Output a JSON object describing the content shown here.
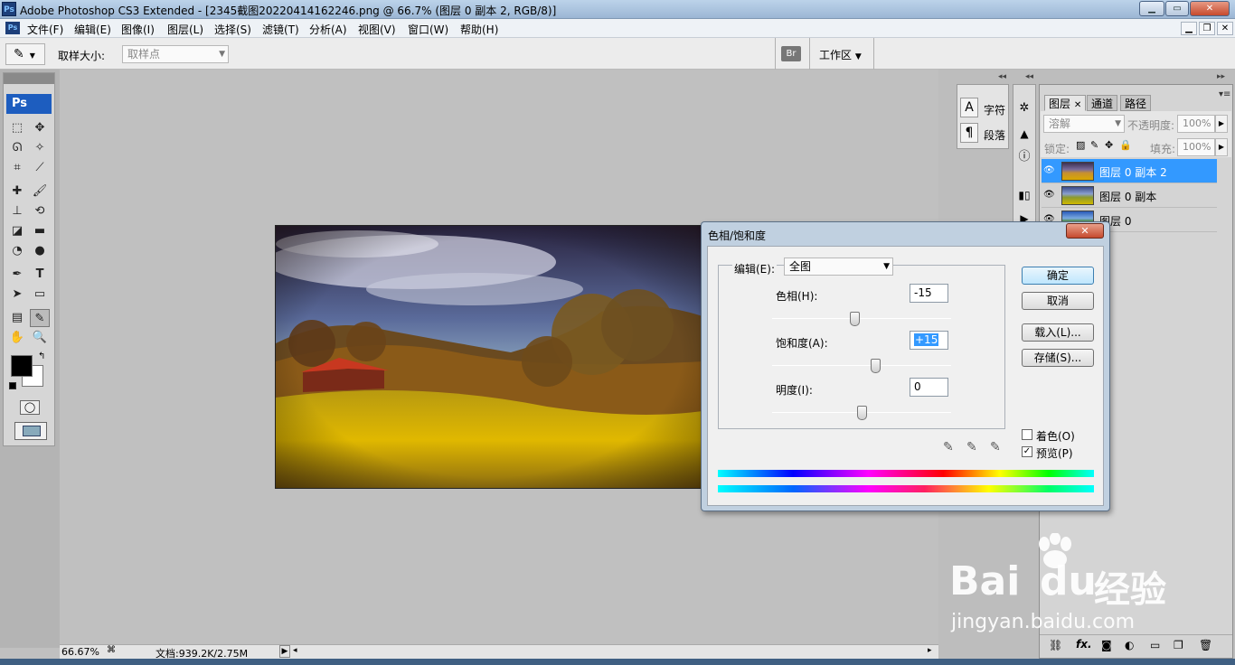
{
  "window": {
    "title": "Adobe Photoshop CS3 Extended - [2345截图20220414162246.png @ 66.7% (图层 0 副本 2, RGB/8)]",
    "app_icon": "Ps"
  },
  "menu": [
    "文件(F)",
    "编辑(E)",
    "图像(I)",
    "图层(L)",
    "选择(S)",
    "滤镜(T)",
    "分析(A)",
    "视图(V)",
    "窗口(W)",
    "帮助(H)"
  ],
  "options": {
    "sample_size_label": "取样大小:",
    "sample_size_value": "取样点",
    "workspace_label": "工作区"
  },
  "toolbox": {
    "logo": "Ps"
  },
  "status": {
    "zoom": "66.67%",
    "doc": "文档:939.2K/2.75M"
  },
  "char_panel": {
    "char_label": "字符",
    "para_label": "段落"
  },
  "layers_panel": {
    "tabs": [
      "图层",
      "通道",
      "路径"
    ],
    "blend_mode": "溶解",
    "opacity_label": "不透明度:",
    "opacity_value": "100%",
    "lock_label": "锁定:",
    "fill_label": "填充:",
    "fill_value": "100%",
    "layers": [
      {
        "name": "图层 0 副本 2",
        "selected": true
      },
      {
        "name": "图层 0 副本",
        "selected": false
      },
      {
        "name": "图层 0",
        "selected": false
      }
    ]
  },
  "dialog": {
    "title": "色相/饱和度",
    "edit_label": "编辑(E):",
    "edit_value": "全图",
    "hue_label": "色相(H):",
    "hue_value": "-15",
    "hue_slider": -15,
    "sat_label": "饱和度(A):",
    "sat_value": "+15",
    "sat_slider": 15,
    "light_label": "明度(I):",
    "light_value": "0",
    "light_slider": 0,
    "ok": "确定",
    "cancel": "取消",
    "load": "载入(L)...",
    "save": "存储(S)...",
    "colorize_label": "着色(O)",
    "colorize": false,
    "preview_label": "预览(P)",
    "preview": true
  },
  "watermark": {
    "brand": "Bai",
    "brand2": "du",
    "cn": "经验",
    "url": "jingyan.baidu.com"
  },
  "colors": {
    "accent": "#3399ff",
    "dialog_frame": "#c0d0e0",
    "canvas_bg": "#c0c0c0"
  }
}
